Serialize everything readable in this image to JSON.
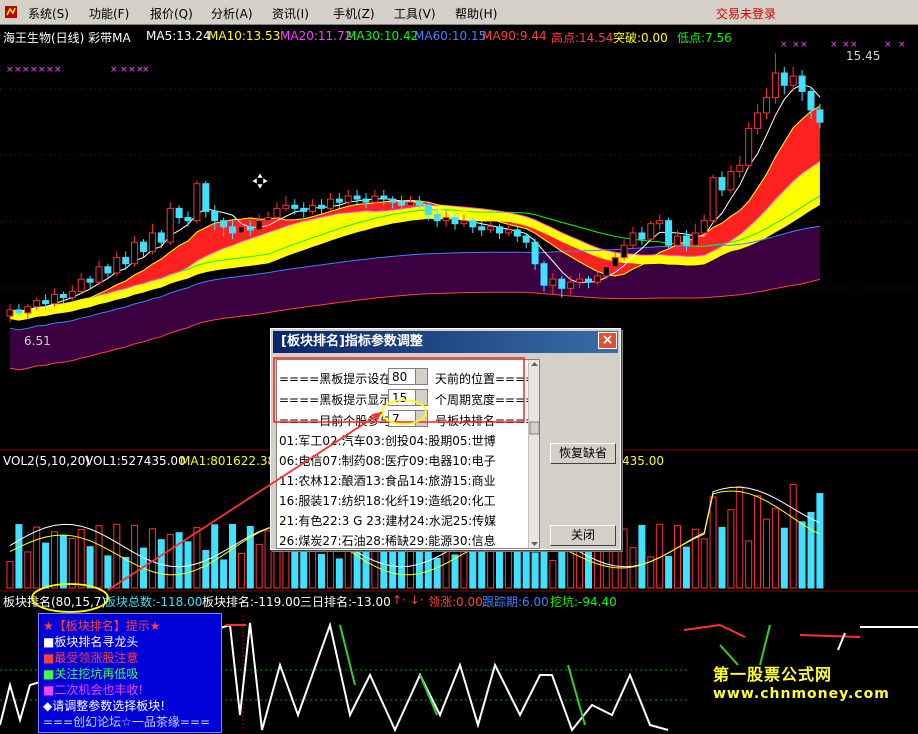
{
  "menu": {
    "items": [
      {
        "label": "系统",
        "key": "S"
      },
      {
        "label": "功能",
        "key": "F"
      },
      {
        "label": "报价",
        "key": "Q"
      },
      {
        "label": "分析",
        "key": "A"
      },
      {
        "label": "资讯",
        "key": "I"
      },
      {
        "label": "手机",
        "key": "Z"
      },
      {
        "label": "工具",
        "key": "V"
      },
      {
        "label": "帮助",
        "key": "H"
      }
    ],
    "login_status": "交易未登录"
  },
  "chart_header": {
    "title": "海王生物(日线) 彩带MA",
    "ma5": "MA5:13.24",
    "ma10": "MA10:13.53",
    "ma20": "MA20:11.72",
    "ma30": "MA30:10.42",
    "ma60": "MA60:10.15",
    "ma90": "MA90:9.44",
    "high": "高点:14.54",
    "breakout": "突破:0.00",
    "low": "低点:7.56",
    "peak_label": "15.45",
    "trough_label": "6.51"
  },
  "volume": {
    "legend_name": "VOL2(5,10,20)",
    "vol1": "VOL1:527435.00",
    "ma1": "MA1:801622.38",
    "tail": "435.00"
  },
  "indicator": {
    "name": "板块排名(80,15,7)",
    "total": "板块总数:-118.00",
    "rank": "板块排名:-119.00",
    "three_day": "三日排名:-13.00",
    "up_down": "↑·  ↓·",
    "leading": "领涨:0.00",
    "follow": "跟踪期:6.00",
    "dig": "挖坑:-94.40"
  },
  "dialog": {
    "title": "[板块排名]指标参数调整",
    "close": "×",
    "params": [
      {
        "pre": "====黑板提示设在:",
        "value": "80",
        "post": "天前的位置===="
      },
      {
        "pre": "====黑板提示显示:",
        "value": "15",
        "post": "个周期宽度===="
      },
      {
        "pre": "====目前个股参与",
        "value": "7",
        "post": "号板块排名===="
      }
    ],
    "sectors": [
      "01:军工02:汽车03:创投04:股期05:世博",
      "06:电信07:制药08:医疗09:电器10:电子",
      "11:农林12:酿酒13:食品14:旅游15:商业",
      "16:服装17:纺织18:化纤19:造纸20:化工",
      "21:有色22:3 G 23:建材24:水泥25:传媒",
      "26:煤炭27:石油28:稀缺29:能源30:信息"
    ],
    "restore_button": "恢复缺省",
    "close_button": "关闭"
  },
  "info_box": {
    "lines": [
      "★【板块排名】提示★",
      "■板块排名寻龙头",
      "■最受领涨股注意",
      "■关注挖坑再低吸",
      "■二次机会也丰收!",
      "◆请调整参数选择板块!",
      "===创幻论坛☆一品茶缘==="
    ]
  },
  "watermark": {
    "site_name": "第一股票公式网",
    "url": "www.chnmoney.com"
  },
  "colors": {
    "up": "#ff3030",
    "down": "#40e0ff",
    "ma5": "#ffffff",
    "ma10": "#ffff00",
    "ma20": "#ff40ff",
    "ma30": "#00ff00",
    "ma60": "#4080ff",
    "ma90": "#ff4040"
  },
  "chart_data": {
    "type": "candlestick",
    "price_range": [
      6.51,
      15.45
    ],
    "candles": [
      [
        6.9,
        7.1,
        6.7,
        7.3
      ],
      [
        7.1,
        7.0,
        6.9,
        7.3
      ],
      [
        7.0,
        7.2,
        6.8,
        7.3
      ],
      [
        7.2,
        7.4,
        7.1,
        7.5
      ],
      [
        7.4,
        7.3,
        7.1,
        7.6
      ],
      [
        7.3,
        7.6,
        7.2,
        7.8
      ],
      [
        7.6,
        7.5,
        7.3,
        7.7
      ],
      [
        7.5,
        7.7,
        7.4,
        7.9
      ],
      [
        7.7,
        8.1,
        7.6,
        8.3
      ],
      [
        8.1,
        8.0,
        7.8,
        8.2
      ],
      [
        8.0,
        8.5,
        7.9,
        8.7
      ],
      [
        8.5,
        8.3,
        8.1,
        8.6
      ],
      [
        8.3,
        8.8,
        8.2,
        9.0
      ],
      [
        8.8,
        8.6,
        8.4,
        9.0
      ],
      [
        8.6,
        9.3,
        8.5,
        9.5
      ],
      [
        9.3,
        9.0,
        8.8,
        9.4
      ],
      [
        9.0,
        9.6,
        8.9,
        9.9
      ],
      [
        9.6,
        9.3,
        9.1,
        9.7
      ],
      [
        9.3,
        10.4,
        9.2,
        10.6
      ],
      [
        10.4,
        10.1,
        9.9,
        10.5
      ],
      [
        10.1,
        10.0,
        9.8,
        10.3
      ],
      [
        10.0,
        11.2,
        9.9,
        11.3
      ],
      [
        11.2,
        10.3,
        10.1,
        11.3
      ],
      [
        10.3,
        10.0,
        9.7,
        10.5
      ],
      [
        10.0,
        9.8,
        9.5,
        10.1
      ],
      [
        9.8,
        9.6,
        9.4,
        10.0
      ],
      [
        9.6,
        9.8,
        9.5,
        10.0
      ],
      [
        9.8,
        9.7,
        9.5,
        10.0
      ],
      [
        9.7,
        10.0,
        9.6,
        10.2
      ],
      [
        10.0,
        10.1,
        9.8,
        10.3
      ],
      [
        10.1,
        10.4,
        10.0,
        10.6
      ],
      [
        10.4,
        10.5,
        10.3,
        10.8
      ],
      [
        10.5,
        10.4,
        10.2,
        10.7
      ],
      [
        10.4,
        10.3,
        10.1,
        10.6
      ],
      [
        10.3,
        10.5,
        10.2,
        10.7
      ],
      [
        10.5,
        10.4,
        10.2,
        10.7
      ],
      [
        10.4,
        10.7,
        10.3,
        10.9
      ],
      [
        10.7,
        10.6,
        10.4,
        10.9
      ],
      [
        10.6,
        10.8,
        10.5,
        11.0
      ],
      [
        10.8,
        10.7,
        10.5,
        11.0
      ],
      [
        10.7,
        10.6,
        10.4,
        10.9
      ],
      [
        10.6,
        10.8,
        10.5,
        11.0
      ],
      [
        10.8,
        10.7,
        10.5,
        11.0
      ],
      [
        10.7,
        10.6,
        10.4,
        10.8
      ],
      [
        10.6,
        10.5,
        10.3,
        10.8
      ],
      [
        10.5,
        10.6,
        10.4,
        10.8
      ],
      [
        10.6,
        10.5,
        10.3,
        10.8
      ],
      [
        10.5,
        10.2,
        10.0,
        10.6
      ],
      [
        10.2,
        10.0,
        9.8,
        10.4
      ],
      [
        10.0,
        10.1,
        9.8,
        10.3
      ],
      [
        10.1,
        9.9,
        9.7,
        10.2
      ],
      [
        9.9,
        10.0,
        9.8,
        10.2
      ],
      [
        10.0,
        9.8,
        9.6,
        10.1
      ],
      [
        9.8,
        9.7,
        9.5,
        10.0
      ],
      [
        9.7,
        9.8,
        9.6,
        10.0
      ],
      [
        9.8,
        9.6,
        9.4,
        9.9
      ],
      [
        9.6,
        9.7,
        9.5,
        9.9
      ],
      [
        9.7,
        9.5,
        9.3,
        9.8
      ],
      [
        9.5,
        9.3,
        9.1,
        9.6
      ],
      [
        9.3,
        8.6,
        8.4,
        9.4
      ],
      [
        8.6,
        7.9,
        7.7,
        8.7
      ],
      [
        7.9,
        8.1,
        7.6,
        8.3
      ],
      [
        8.1,
        7.8,
        7.5,
        8.2
      ],
      [
        7.8,
        8.0,
        7.6,
        8.2
      ],
      [
        8.0,
        8.1,
        7.8,
        8.3
      ],
      [
        8.1,
        8.0,
        7.8,
        8.2
      ],
      [
        8.0,
        8.2,
        7.9,
        8.4
      ],
      [
        8.2,
        8.5,
        8.1,
        8.7
      ],
      [
        8.5,
        8.8,
        8.4,
        9.0
      ],
      [
        8.8,
        9.2,
        8.7,
        9.4
      ],
      [
        9.2,
        9.6,
        9.1,
        9.8
      ],
      [
        9.6,
        9.4,
        9.2,
        9.8
      ],
      [
        9.4,
        9.9,
        9.3,
        10.0
      ],
      [
        9.9,
        10.0,
        9.7,
        10.2
      ],
      [
        10.0,
        9.2,
        9.1,
        10.1
      ],
      [
        9.2,
        9.5,
        9.0,
        9.7
      ],
      [
        9.5,
        9.2,
        9.0,
        9.7
      ],
      [
        9.2,
        9.6,
        9.1,
        9.9
      ],
      [
        9.6,
        10.0,
        9.5,
        10.2
      ],
      [
        10.0,
        11.4,
        9.9,
        11.5
      ],
      [
        11.4,
        11.0,
        10.8,
        11.6
      ],
      [
        11.0,
        11.6,
        10.9,
        11.8
      ],
      [
        11.6,
        11.8,
        11.4,
        12.1
      ],
      [
        11.8,
        13.0,
        11.7,
        13.2
      ],
      [
        13.0,
        13.5,
        12.8,
        13.8
      ],
      [
        13.5,
        14.0,
        13.3,
        14.3
      ],
      [
        14.0,
        14.8,
        13.8,
        15.45
      ],
      [
        14.8,
        14.4,
        14.1,
        15.0
      ],
      [
        14.4,
        14.7,
        14.2,
        15.0
      ],
      [
        14.7,
        14.2,
        13.9,
        14.9
      ],
      [
        14.2,
        13.6,
        13.3,
        14.3
      ],
      [
        13.6,
        13.2,
        13.0,
        13.8
      ]
    ]
  }
}
